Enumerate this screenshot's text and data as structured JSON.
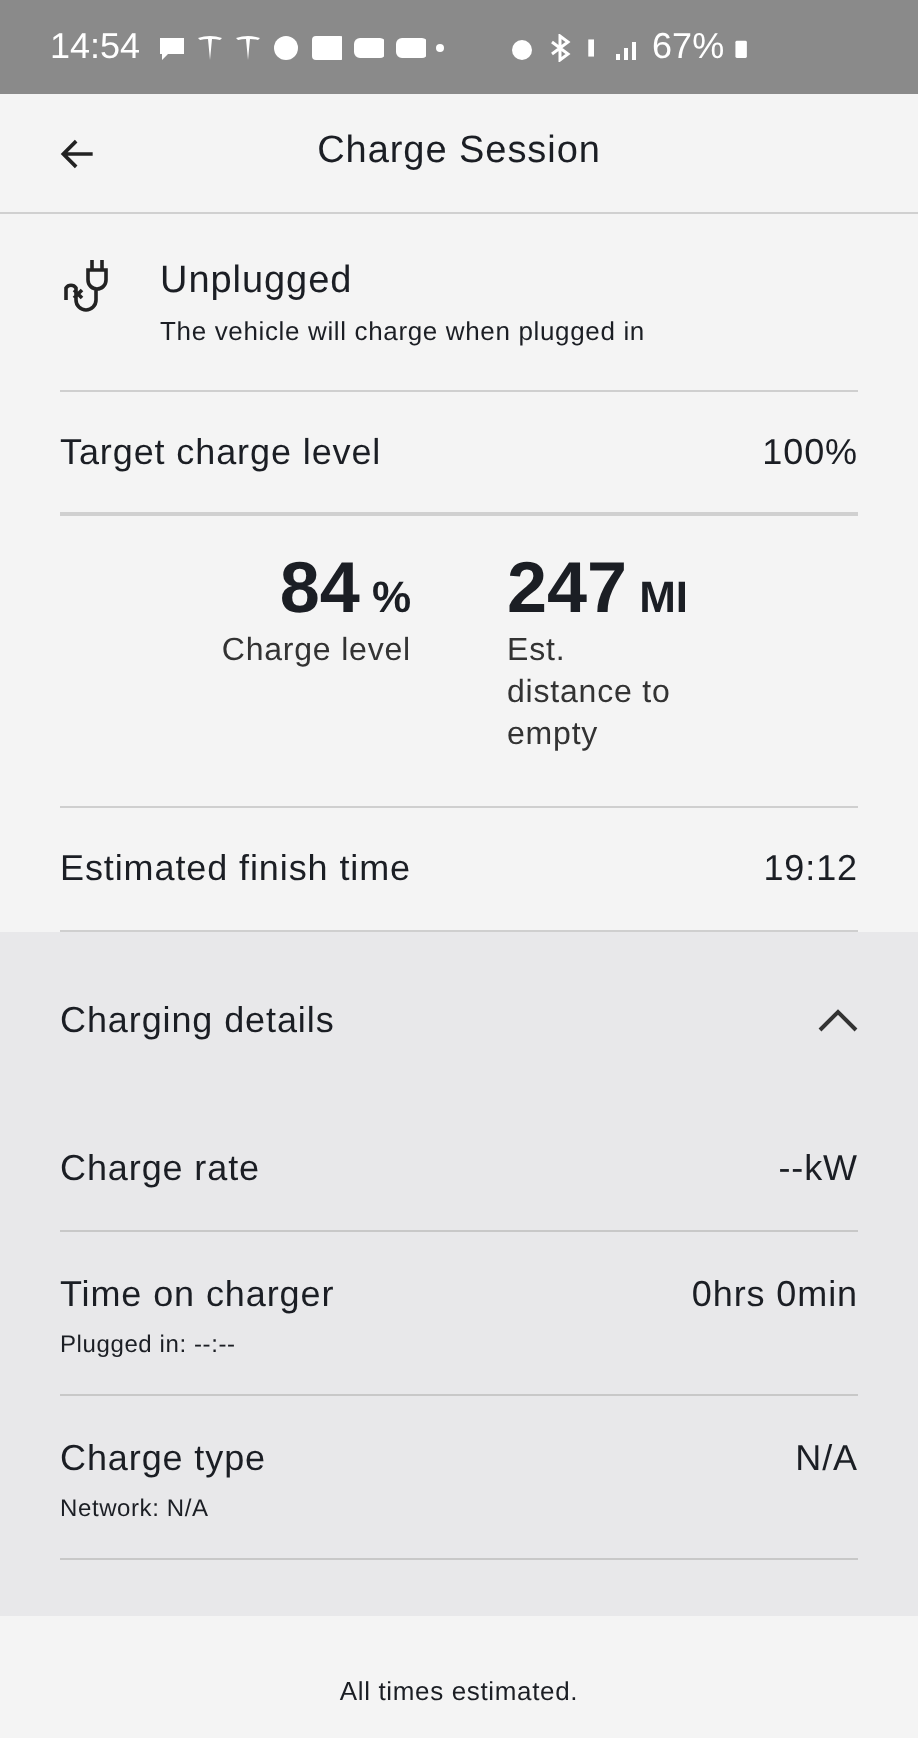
{
  "status_bar": {
    "time": "14:54",
    "battery": "67%"
  },
  "header": {
    "title": "Charge Session"
  },
  "plug_status": {
    "title": "Unplugged",
    "subtitle": "The vehicle will charge when plugged in"
  },
  "target": {
    "label": "Target charge level",
    "value": "100%"
  },
  "stats": [
    {
      "value": "84",
      "unit": "%",
      "label": "Charge level"
    },
    {
      "value": "247",
      "unit": "MI",
      "label": "Est. distance to empty"
    }
  ],
  "finish": {
    "label": "Estimated finish time",
    "value": "19:12"
  },
  "details": {
    "title": "Charging details",
    "expanded": true,
    "rows": [
      {
        "label": "Charge rate",
        "value": "--kW"
      },
      {
        "label": "Time on charger",
        "value": "0hrs 0min",
        "sub": "Plugged in: --:--"
      },
      {
        "label": "Charge type",
        "value": "N/A",
        "sub": "Network: N/A"
      }
    ]
  },
  "footer": "All times estimated."
}
